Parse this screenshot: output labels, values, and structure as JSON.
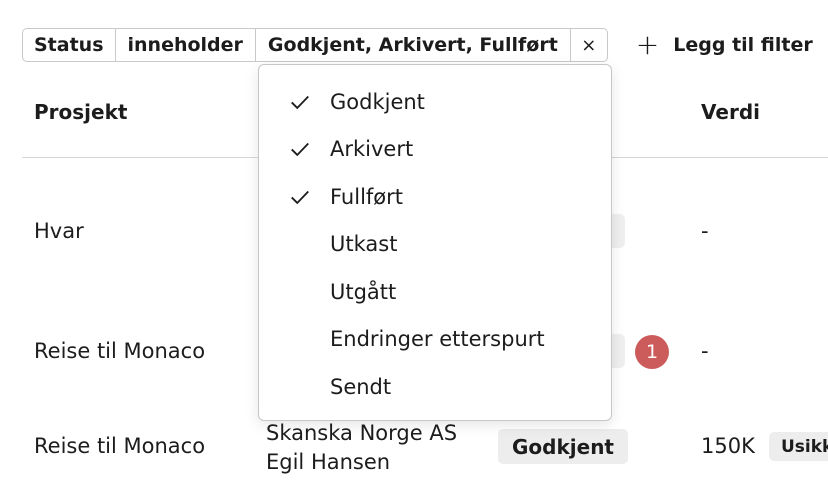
{
  "filter": {
    "field": "Status",
    "operator": "inneholder",
    "value": "Godkjent, Arkivert, Fullført",
    "close": "×",
    "add_label": "Legg til filter",
    "add_icon": "+"
  },
  "table": {
    "columns": {
      "project": "Prosjekt",
      "value": "Verdi"
    },
    "rows": [
      {
        "project": "Hvar",
        "value": "-"
      },
      {
        "project": "Reise til Monaco",
        "value": "-",
        "notification_count": "1"
      },
      {
        "project": "Reise til Monaco",
        "company": "Skanska Norge AS",
        "contact": "Egil Hansen",
        "status": "Godkjent",
        "value": "150K",
        "tag": "Usikk"
      }
    ]
  },
  "dropdown": {
    "options": [
      {
        "label": "Godkjent",
        "checked": true
      },
      {
        "label": "Arkivert",
        "checked": true
      },
      {
        "label": "Fullført",
        "checked": true
      },
      {
        "label": "Utkast",
        "checked": false
      },
      {
        "label": "Utgått",
        "checked": false
      },
      {
        "label": "Endringer etterspurt",
        "checked": false
      },
      {
        "label": "Sendt",
        "checked": false
      }
    ]
  },
  "colors": {
    "notification": "#cc5b5b",
    "badge_bg": "#ededed",
    "border": "#c9c9c9"
  },
  "icons": {
    "check": "check-icon",
    "close": "close-icon",
    "add": "plus-icon"
  }
}
